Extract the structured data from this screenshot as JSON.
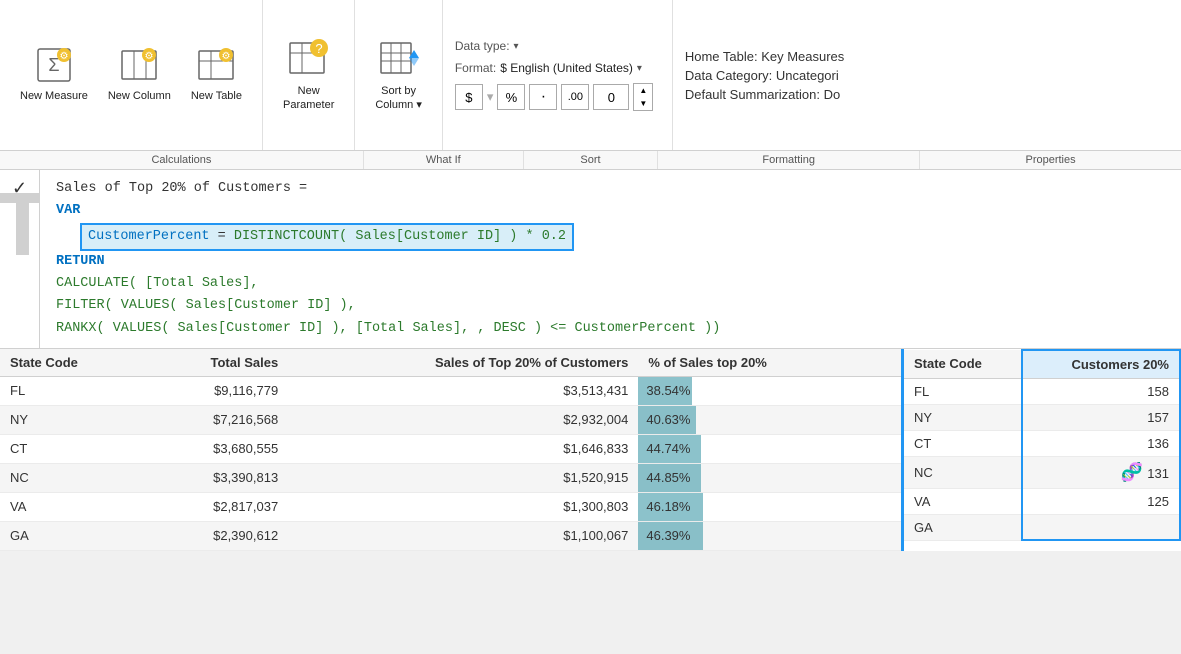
{
  "ribbon": {
    "groups": [
      {
        "id": "calculations",
        "label": "Calculations",
        "items": [
          {
            "id": "new-measure",
            "label": "New\nMeasure",
            "icon": "calc"
          },
          {
            "id": "new-column",
            "label": "New\nColumn",
            "icon": "table-col"
          },
          {
            "id": "new-table",
            "label": "New\nTable",
            "icon": "table"
          }
        ]
      },
      {
        "id": "what-if",
        "label": "What If",
        "items": [
          {
            "id": "new-parameter",
            "label": "New\nParameter",
            "icon": "table-question"
          }
        ]
      },
      {
        "id": "sort",
        "label": "Sort",
        "items": [
          {
            "id": "sort-by-column",
            "label": "Sort by\nColumn",
            "icon": "sort"
          }
        ]
      },
      {
        "id": "formatting",
        "label": "Formatting",
        "data_type_label": "Data type:",
        "format_label": "Format: $ English (United States)",
        "format_symbols": [
          "$",
          "%",
          "·",
          ".00"
        ],
        "decimal_value": "0"
      },
      {
        "id": "properties",
        "label": "Properties",
        "home_table": "Home Table: Key Measures",
        "data_category": "Data Category: Uncategori",
        "default_summarization": "Default Summarization: Do"
      }
    ]
  },
  "formula": {
    "title": "Sales of Top 20% of Customers =",
    "var_keyword": "VAR",
    "var_name": "CustomerPercent",
    "var_value": "DISTINCTCOUNT( Sales[Customer ID] ) * 0.2",
    "return_keyword": "RETURN",
    "calculate": "CALCULATE( [Total Sales],",
    "filter": "    FILTER( VALUES( Sales[Customer ID] ),",
    "rankx": "        RANKX( VALUES( Sales[Customer ID] ), [Total Sales], , DESC ) <= CustomerPercent ))"
  },
  "left_table": {
    "columns": [
      {
        "id": "state-code",
        "label": "State Code",
        "numeric": false
      },
      {
        "id": "total-sales",
        "label": "Total Sales",
        "numeric": true
      },
      {
        "id": "sales-top20",
        "label": "Sales of Top 20% of Customers",
        "numeric": true
      },
      {
        "id": "pct-top20",
        "label": "% of Sales top 20%",
        "numeric": false
      }
    ],
    "rows": [
      {
        "state": "FL",
        "total_sales": "$9,116,779",
        "sales_top20": "$3,513,431",
        "pct": "38.54%",
        "bar_pct": 38
      },
      {
        "state": "NY",
        "total_sales": "$7,216,568",
        "sales_top20": "$2,932,004",
        "pct": "40.63%",
        "bar_pct": 41
      },
      {
        "state": "CT",
        "total_sales": "$3,680,555",
        "sales_top20": "$1,646,833",
        "pct": "44.74%",
        "bar_pct": 45
      },
      {
        "state": "NC",
        "total_sales": "$3,390,813",
        "sales_top20": "$1,520,915",
        "pct": "44.85%",
        "bar_pct": 45
      },
      {
        "state": "VA",
        "total_sales": "$2,817,037",
        "sales_top20": "$1,300,803",
        "pct": "46.18%",
        "bar_pct": 46
      },
      {
        "state": "GA",
        "total_sales": "$2,390,612",
        "sales_top20": "$1,100,067",
        "pct": "46.39%",
        "bar_pct": 46
      }
    ]
  },
  "right_table": {
    "columns": [
      {
        "id": "state-code-r",
        "label": "State Code",
        "numeric": false,
        "highlighted": false
      },
      {
        "id": "customers-20",
        "label": "Customers 20%",
        "numeric": true,
        "highlighted": true
      }
    ],
    "rows": [
      {
        "state": "FL",
        "customers": "158"
      },
      {
        "state": "NY",
        "customers": "157"
      },
      {
        "state": "CT",
        "customers": "136"
      },
      {
        "state": "NC",
        "customers": "131"
      },
      {
        "state": "VA",
        "customers": "125"
      },
      {
        "state": "GA",
        "customers": ""
      }
    ]
  },
  "sidebar": {
    "big_letter": "Te"
  }
}
